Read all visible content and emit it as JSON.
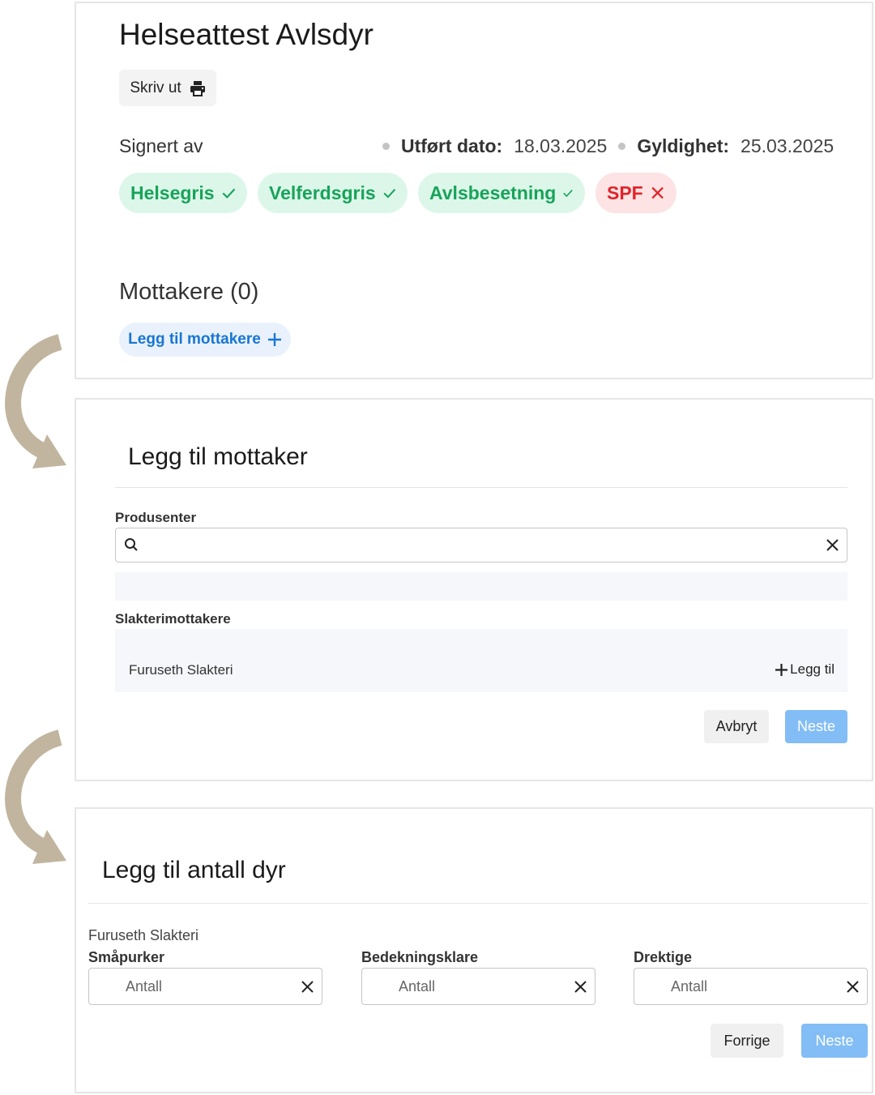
{
  "certificate": {
    "title": "Helseattest Avlsdyr",
    "print_label": "Skriv ut",
    "signed_label": "Signert av",
    "performed_label": "Utført dato:",
    "performed_value": "18.03.2025",
    "validity_label": "Gyldighet:",
    "validity_value": "25.03.2025",
    "chips": [
      {
        "label": "Helsegris",
        "status": "ok"
      },
      {
        "label": "Velferdsgris",
        "status": "ok"
      },
      {
        "label": "Avlsbesetning",
        "status": "ok"
      },
      {
        "label": "SPF",
        "status": "bad"
      }
    ],
    "recipients_title": "Mottakere (0)",
    "add_recipients_label": "Legg til mottakere"
  },
  "add_recipient": {
    "title": "Legg til mottaker",
    "producers_label": "Produsenter",
    "search_value": "",
    "slaughter_label": "Slakterimottakere",
    "slaughter_items": [
      {
        "name": "Furuseth Slakteri",
        "action": "Legg til"
      }
    ],
    "cancel_label": "Avbryt",
    "next_label": "Neste"
  },
  "add_count": {
    "title": "Legg til antall dyr",
    "recipient_name": "Furuseth Slakteri",
    "fields": [
      {
        "label": "Småpurker",
        "placeholder": "Antall"
      },
      {
        "label": "Bedekningsklare",
        "placeholder": "Antall"
      },
      {
        "label": "Drektige",
        "placeholder": "Antall"
      }
    ],
    "prev_label": "Forrige",
    "next_label": "Neste"
  },
  "colors": {
    "success": "#19a35a",
    "success_bg": "#dcf7ea",
    "danger": "#e0232b",
    "danger_bg": "#fde3e3",
    "primary": "#1976d2",
    "primary_light": "#82bdf6",
    "arrow": "#c2b59f"
  },
  "icons": {
    "print": "printer-icon",
    "check": "check-icon",
    "cross": "close-icon",
    "plus": "plus-icon",
    "search": "search-icon",
    "clear": "clear-icon",
    "flow": "curved-arrow-icon"
  }
}
